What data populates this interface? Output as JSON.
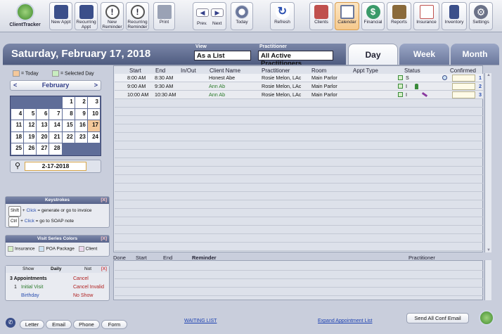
{
  "app": {
    "name": "ClientTracker"
  },
  "toolbar": {
    "new_appt": "New Appt",
    "recurring_appt": "Recurring Appt",
    "new_reminder": "New Reminder",
    "recurring_reminder": "Recurring Reminder",
    "print": "Print",
    "prev": "Prev.",
    "next": "Next",
    "today": "Today",
    "refresh": "Refresh",
    "clients": "Clients",
    "calendar": "Calendar",
    "financial": "Financial",
    "reports": "Reports",
    "insurance": "Insurance",
    "inventory": "Inventory",
    "settings": "Settings"
  },
  "header": {
    "date": "Saturday, February 17, 2018",
    "view_label": "View",
    "view_value": "As a List",
    "practitioner_label": "Practitioner",
    "practitioner_value": "All Active Practitioners",
    "tabs": [
      "Day",
      "Week",
      "Month"
    ]
  },
  "calendar": {
    "legend_today": "= Today",
    "legend_selected": "= Selected Day",
    "month": "February",
    "prev": "<",
    "next": ">",
    "weeks": [
      [
        "",
        "",
        "",
        "",
        "1",
        "2",
        "3"
      ],
      [
        "4",
        "5",
        "6",
        "7",
        "8",
        "9",
        "10"
      ],
      [
        "11",
        "12",
        "13",
        "14",
        "15",
        "16",
        "17"
      ],
      [
        "18",
        "19",
        "20",
        "21",
        "22",
        "23",
        "24"
      ],
      [
        "25",
        "26",
        "27",
        "28",
        "",
        "",
        ""
      ]
    ],
    "search_value": "2-17-2018"
  },
  "keystrokes": {
    "title": "Keystrokes",
    "close": "[X]",
    "shift_key": "Shift",
    "ctrl_key": "Ctrl",
    "plus": "+",
    "click": "Click",
    "shift_desc": "= generate or go to invoice",
    "ctrl_desc": "= go to SOAP note"
  },
  "visit_colors": {
    "title": "Visit Series Colors",
    "close": "[X]",
    "items": [
      "Insurance",
      "POA Package",
      "Client"
    ]
  },
  "summary": {
    "show": "Show",
    "daily": "Daily",
    "not": "Not",
    "close": "[X]",
    "count_label": "3 Appointments",
    "count_num": "1",
    "initial_visit": "Initial Visit",
    "birthday": "Birthday",
    "cancel": "Cancel",
    "cancel_invalid": "Cancel Invalid",
    "no_show": "No Show"
  },
  "appointments": {
    "headers": [
      "Start",
      "End",
      "In/Out",
      "Client Name",
      "Practitioner",
      "Room",
      "Appt Type",
      "Status",
      "Confirmed"
    ],
    "rows": [
      {
        "start": "8:00 AM",
        "end": "8:30 AM",
        "client": "Honest Abe",
        "practitioner": "Rosie Melon, LAc",
        "room": "Main Parlor",
        "status": "S",
        "num": "1"
      },
      {
        "start": "9:00 AM",
        "end": "9:30 AM",
        "client": "Ann Ab",
        "practitioner": "Rosie Melon, LAc",
        "room": "Main Parlor",
        "status": "I",
        "num": "2"
      },
      {
        "start": "10:00 AM",
        "end": "10:30 AM",
        "client": "Ann Ab",
        "practitioner": "Rosie Melon, LAc",
        "room": "Main Parlor",
        "status": "I",
        "num": "3"
      }
    ]
  },
  "reminders": {
    "headers": [
      "Done",
      "Start",
      "End",
      "Reminder",
      "Practitioner"
    ]
  },
  "footer": {
    "letter": "Letter",
    "email": "Email",
    "phone": "Phone",
    "form": "Form",
    "waiting_list": "WAITING LIST",
    "expand": "Expand Appointment List",
    "send_all": "Send All Conf Email"
  },
  "colors": {
    "today": "#f4c89a",
    "selected": "#c8edc0",
    "accent": "#5f6d98"
  }
}
